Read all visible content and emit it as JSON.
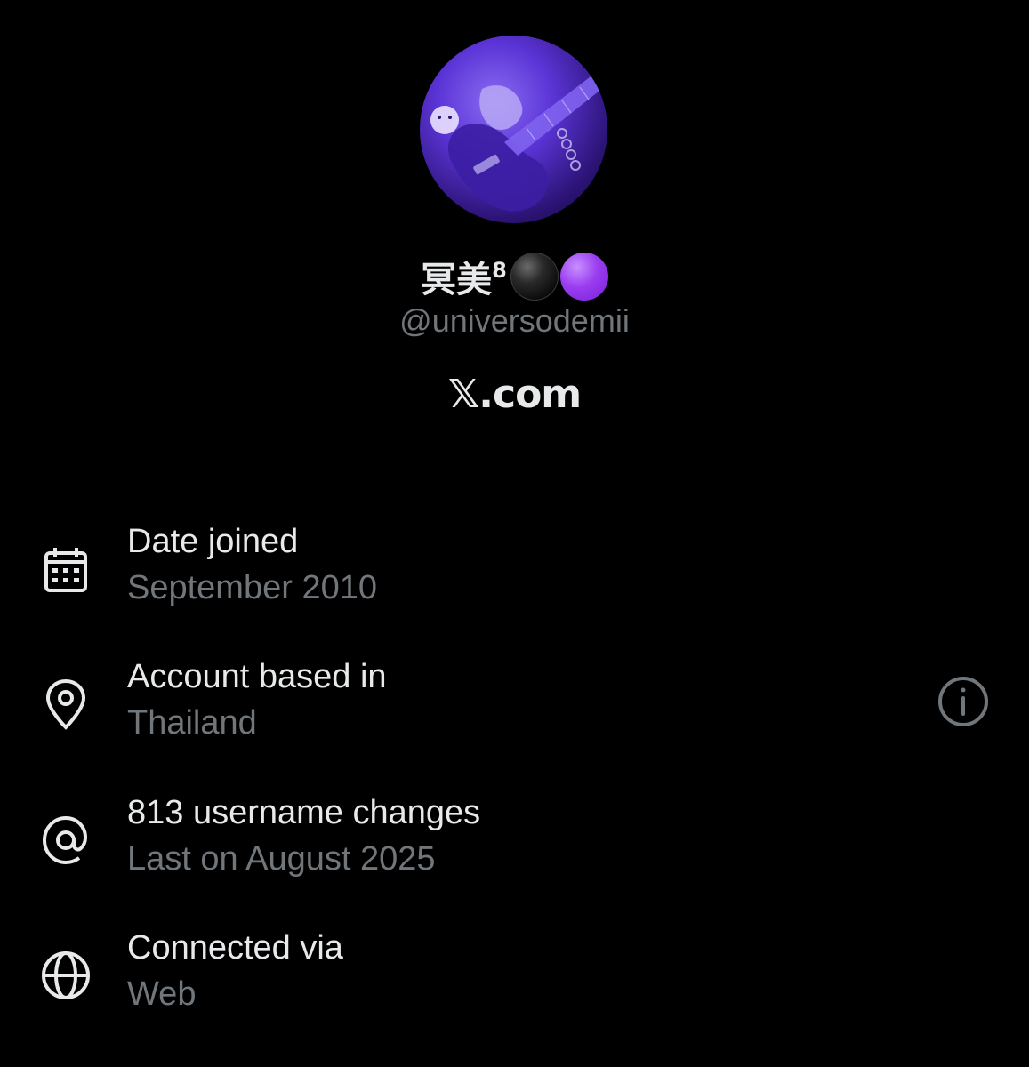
{
  "profile": {
    "display_name": "冥美",
    "name_superscript": "8",
    "handle": "@universodemii",
    "brand": "𝕏.com"
  },
  "details": [
    {
      "title": "Date joined",
      "value": "September 2010",
      "icon": "calendar-icon"
    },
    {
      "title": "Account based in",
      "value": "Thailand",
      "icon": "location-pin-icon"
    },
    {
      "title": "813 username changes",
      "value": "Last on August 2025",
      "icon": "at-sign-icon"
    },
    {
      "title": "Connected via",
      "value": "Web",
      "icon": "globe-icon"
    }
  ],
  "colors": {
    "background": "#000000",
    "primary_text": "#e7e9ea",
    "secondary_text": "#71767b",
    "avatar_accent": "#5b34d6",
    "emoji_purple": "#9a3df0"
  }
}
